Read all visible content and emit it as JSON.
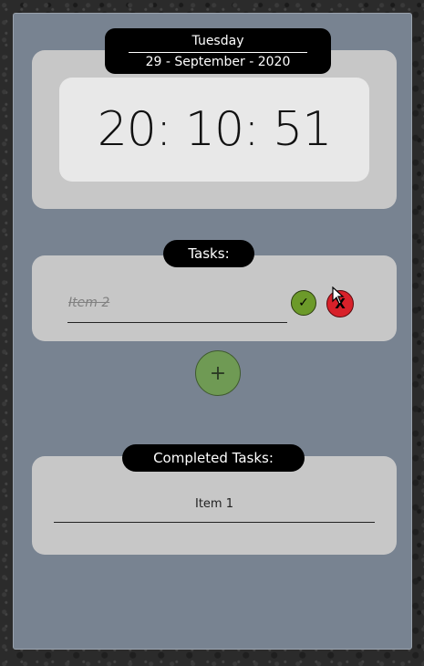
{
  "date": {
    "day": "Tuesday",
    "full": "29 - September - 2020"
  },
  "clock": {
    "time": "20: 10: 51"
  },
  "tasks": {
    "header": "Tasks:",
    "items": [
      {
        "text": "Item 2",
        "completed_style": true
      }
    ],
    "check_icon": "✓",
    "delete_icon": "X",
    "add_icon": "+"
  },
  "completed": {
    "header": "Completed Tasks:",
    "items": [
      {
        "text": "Item 1"
      }
    ]
  },
  "colors": {
    "panel": "#788391",
    "card": "#c7c7c7",
    "check": "#6c9a2a",
    "delete": "#d8212a",
    "add": "#6f9a54"
  }
}
